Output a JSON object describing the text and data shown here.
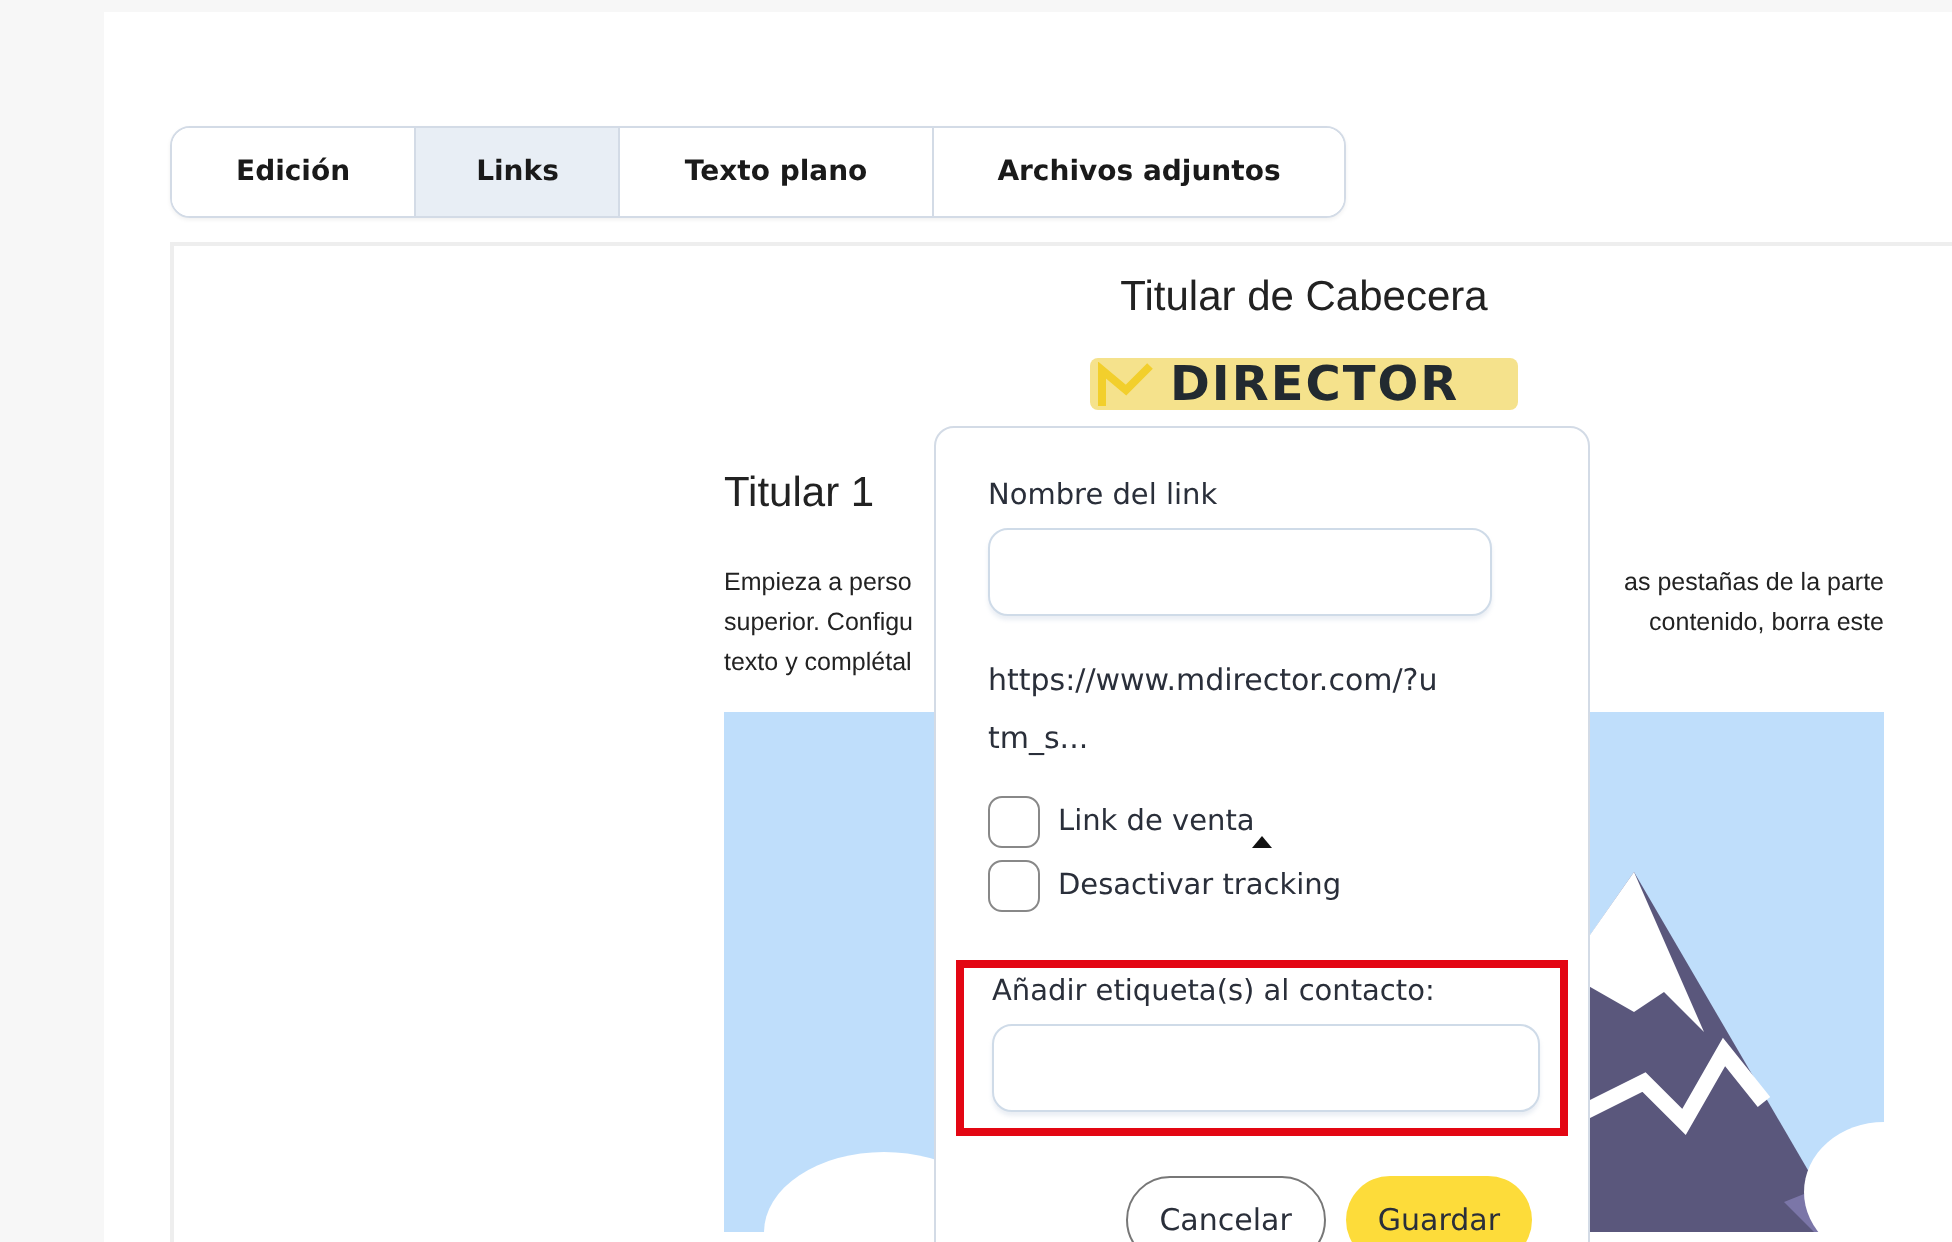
{
  "tabs": [
    {
      "label": "Edición",
      "selected": false
    },
    {
      "label": "Links",
      "selected": true
    },
    {
      "label": "Texto plano",
      "selected": false
    },
    {
      "label": "Archivos adjuntos",
      "selected": false
    }
  ],
  "email": {
    "header_title": "Titular de Cabecera",
    "logo_text": "DIRECTOR",
    "heading": "Titular 1",
    "paragraph_left": [
      "Empieza a perso",
      "superior. Configu",
      "texto y complétal"
    ],
    "paragraph_right": [
      "as pestañas de la parte",
      "contenido, borra este"
    ]
  },
  "link_popup": {
    "name_label": "Nombre del link",
    "url": "https://www.mdirector.com/?utm_s...",
    "checkboxes": [
      {
        "label": "Link de venta",
        "checked": false
      },
      {
        "label": "Desactivar tracking",
        "checked": false
      }
    ],
    "tags_label": "Añadir etiqueta(s) al contacto:",
    "tags_highlighted": true,
    "buttons": [
      {
        "label": "Cancelar",
        "kind": "secondary"
      },
      {
        "label": "Guardar",
        "kind": "primary"
      }
    ]
  }
}
